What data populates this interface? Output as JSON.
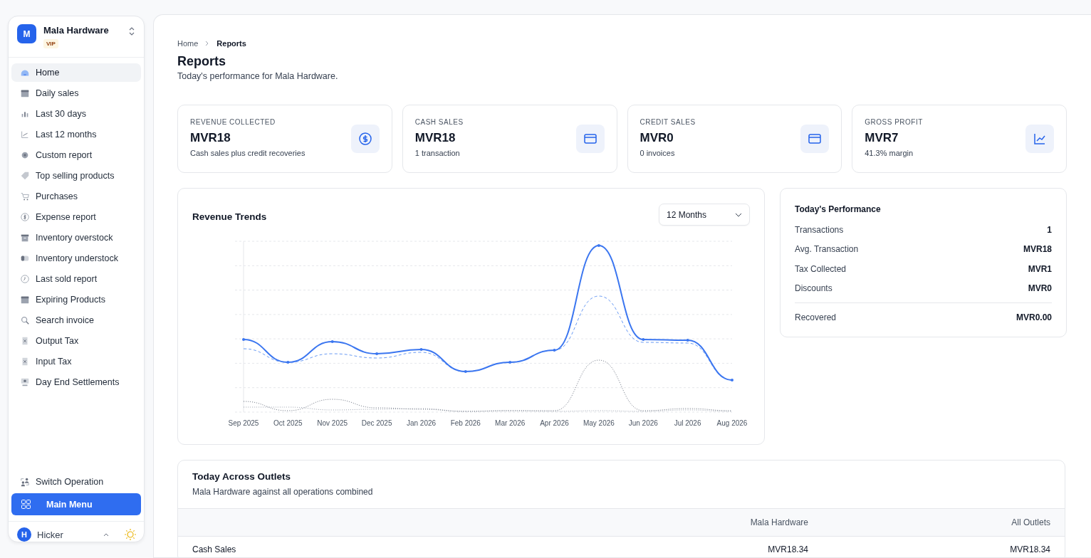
{
  "sidebar": {
    "store": {
      "initial": "M",
      "name": "Mala Hardware",
      "badge": "VIP"
    },
    "items": [
      {
        "label": "Home",
        "selected": true
      },
      {
        "label": "Daily sales",
        "selected": false
      },
      {
        "label": "Last 30 days",
        "selected": false
      },
      {
        "label": "Last 12 months",
        "selected": false
      },
      {
        "label": "Custom report",
        "selected": false
      },
      {
        "label": "Top selling products",
        "selected": false
      },
      {
        "label": "Purchases",
        "selected": false
      },
      {
        "label": "Expense report",
        "selected": false
      },
      {
        "label": "Inventory overstock",
        "selected": false
      },
      {
        "label": "Inventory understock",
        "selected": false
      },
      {
        "label": "Last sold report",
        "selected": false
      },
      {
        "label": "Expiring Products",
        "selected": false
      },
      {
        "label": "Search invoice",
        "selected": false
      },
      {
        "label": "Output Tax",
        "selected": false
      },
      {
        "label": "Input Tax",
        "selected": false
      },
      {
        "label": "Day End Settlements",
        "selected": false
      }
    ],
    "switch_operation": "Switch Operation",
    "main_menu": "Main Menu",
    "user": {
      "initial": "H",
      "name": "Hicker"
    }
  },
  "breadcrumb": [
    {
      "label": "Home",
      "selected": false
    },
    {
      "label": "Reports",
      "selected": true
    }
  ],
  "title": "Reports",
  "subtitle": "Today's performance for Mala Hardware.",
  "stats": [
    {
      "label": "REVENUE COLLECTED",
      "value": "MVR18",
      "note": "Cash sales plus credit recoveries"
    },
    {
      "label": "CASH SALES",
      "value": "MVR18",
      "note": "1 transaction"
    },
    {
      "label": "CREDIT SALES",
      "value": "MVR0",
      "note": "0 invoices"
    },
    {
      "label": "GROSS PROFIT",
      "value": "MVR7",
      "note": "41.3% margin"
    }
  ],
  "revenue_trends": {
    "title": "Revenue Trends",
    "range": "12 Months",
    "x_labels": [
      "Sep 2025",
      "Oct 2025",
      "Nov 2025",
      "Dec 2025",
      "Jan 2026",
      "Feb 2026",
      "Mar 2026",
      "Apr 2026",
      "May 2026",
      "Jun 2026",
      "Jul 2026",
      "Aug 2026"
    ]
  },
  "performance": {
    "title": "Today's Performance",
    "rows": [
      {
        "label": "Transactions",
        "value": "1",
        "kind": "plain"
      },
      {
        "label": "Avg. Transaction",
        "value": "MVR18",
        "kind": "plain"
      },
      {
        "label": "Tax Collected",
        "value": "MVR1",
        "kind": "plain"
      },
      {
        "label": "Discounts",
        "value": "MVR0",
        "kind": "plain"
      },
      {
        "label": "Recovered",
        "value": "MVR0.00",
        "kind": "total"
      }
    ]
  },
  "outlets": {
    "title": "Today Across Outlets",
    "subtitle": "Mala Hardware against all operations combined",
    "columns": [
      "Mala Hardware",
      "All Outlets"
    ],
    "rows": [
      {
        "label": "Cash Sales",
        "values": [
          "MVR18.34",
          "MVR18.34"
        ]
      }
    ]
  }
}
